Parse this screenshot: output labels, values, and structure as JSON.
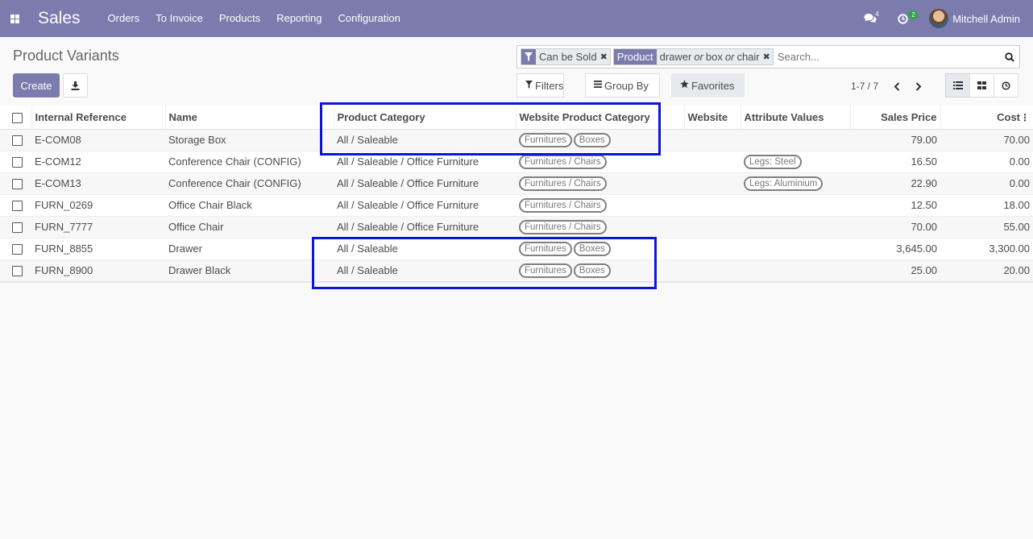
{
  "navbar": {
    "app_name": "Sales",
    "menu": [
      "Orders",
      "To Invoice",
      "Products",
      "Reporting",
      "Configuration"
    ],
    "messages_count": "4",
    "activities_count": "2",
    "user_name": "Mitchell Admin",
    "icons": {
      "apps": "apps-grid-icon",
      "messages": "chat-icon",
      "activities": "clock-icon"
    }
  },
  "control_panel": {
    "title": "Product Variants",
    "create_label": "Create",
    "download_icon": "download-icon",
    "search": {
      "facet1_value": "Can be Sold",
      "facet2_label": "Product",
      "facet2_values": [
        "drawer",
        "box",
        "chair"
      ],
      "facet2_or": "or",
      "placeholder": "Search..."
    },
    "filters_label": "Filters",
    "group_by_label": "Group By",
    "favorites_label": "Favorites",
    "pager": "1-7 / 7"
  },
  "colors": {
    "brand": "#7c7bad",
    "highlight": "#0c15d8"
  },
  "table": {
    "columns": [
      "Internal Reference",
      "Name",
      "Product Category",
      "Website Product Category",
      "Website",
      "Attribute Values",
      "Sales Price",
      "Cost"
    ],
    "rows": [
      {
        "ref": "E-COM08",
        "name": "Storage Box",
        "category": "All / Saleable",
        "web_cat_1": "Furnitures",
        "web_cat_2": "Boxes",
        "website": "",
        "attr": "",
        "price": "79.00",
        "cost": "70.00"
      },
      {
        "ref": "E-COM12",
        "name": "Conference Chair (CONFIG)",
        "category": "All / Saleable / Office Furniture",
        "web_cat_1": "Furnitures / Chairs",
        "web_cat_2": "",
        "website": "",
        "attr": "Legs: Steel",
        "price": "16.50",
        "cost": "0.00"
      },
      {
        "ref": "E-COM13",
        "name": "Conference Chair (CONFIG)",
        "category": "All / Saleable / Office Furniture",
        "web_cat_1": "Furnitures / Chairs",
        "web_cat_2": "",
        "website": "",
        "attr": "Legs: Aluminium",
        "price": "22.90",
        "cost": "0.00"
      },
      {
        "ref": "FURN_0269",
        "name": "Office Chair Black",
        "category": "All / Saleable / Office Furniture",
        "web_cat_1": "Furnitures / Chairs",
        "web_cat_2": "",
        "website": "",
        "attr": "",
        "price": "12.50",
        "cost": "18.00"
      },
      {
        "ref": "FURN_7777",
        "name": "Office Chair",
        "category": "All / Saleable / Office Furniture",
        "web_cat_1": "Furnitures / Chairs",
        "web_cat_2": "",
        "website": "",
        "attr": "",
        "price": "70.00",
        "cost": "55.00"
      },
      {
        "ref": "FURN_8855",
        "name": "Drawer",
        "category": "All / Saleable",
        "web_cat_1": "Furnitures",
        "web_cat_2": "Boxes",
        "website": "",
        "attr": "",
        "price": "3,645.00",
        "cost": "3,300.00"
      },
      {
        "ref": "FURN_8900",
        "name": "Drawer Black",
        "category": "All / Saleable",
        "web_cat_1": "Furnitures",
        "web_cat_2": "Boxes",
        "website": "",
        "attr": "",
        "price": "25.00",
        "cost": "20.00"
      }
    ]
  }
}
